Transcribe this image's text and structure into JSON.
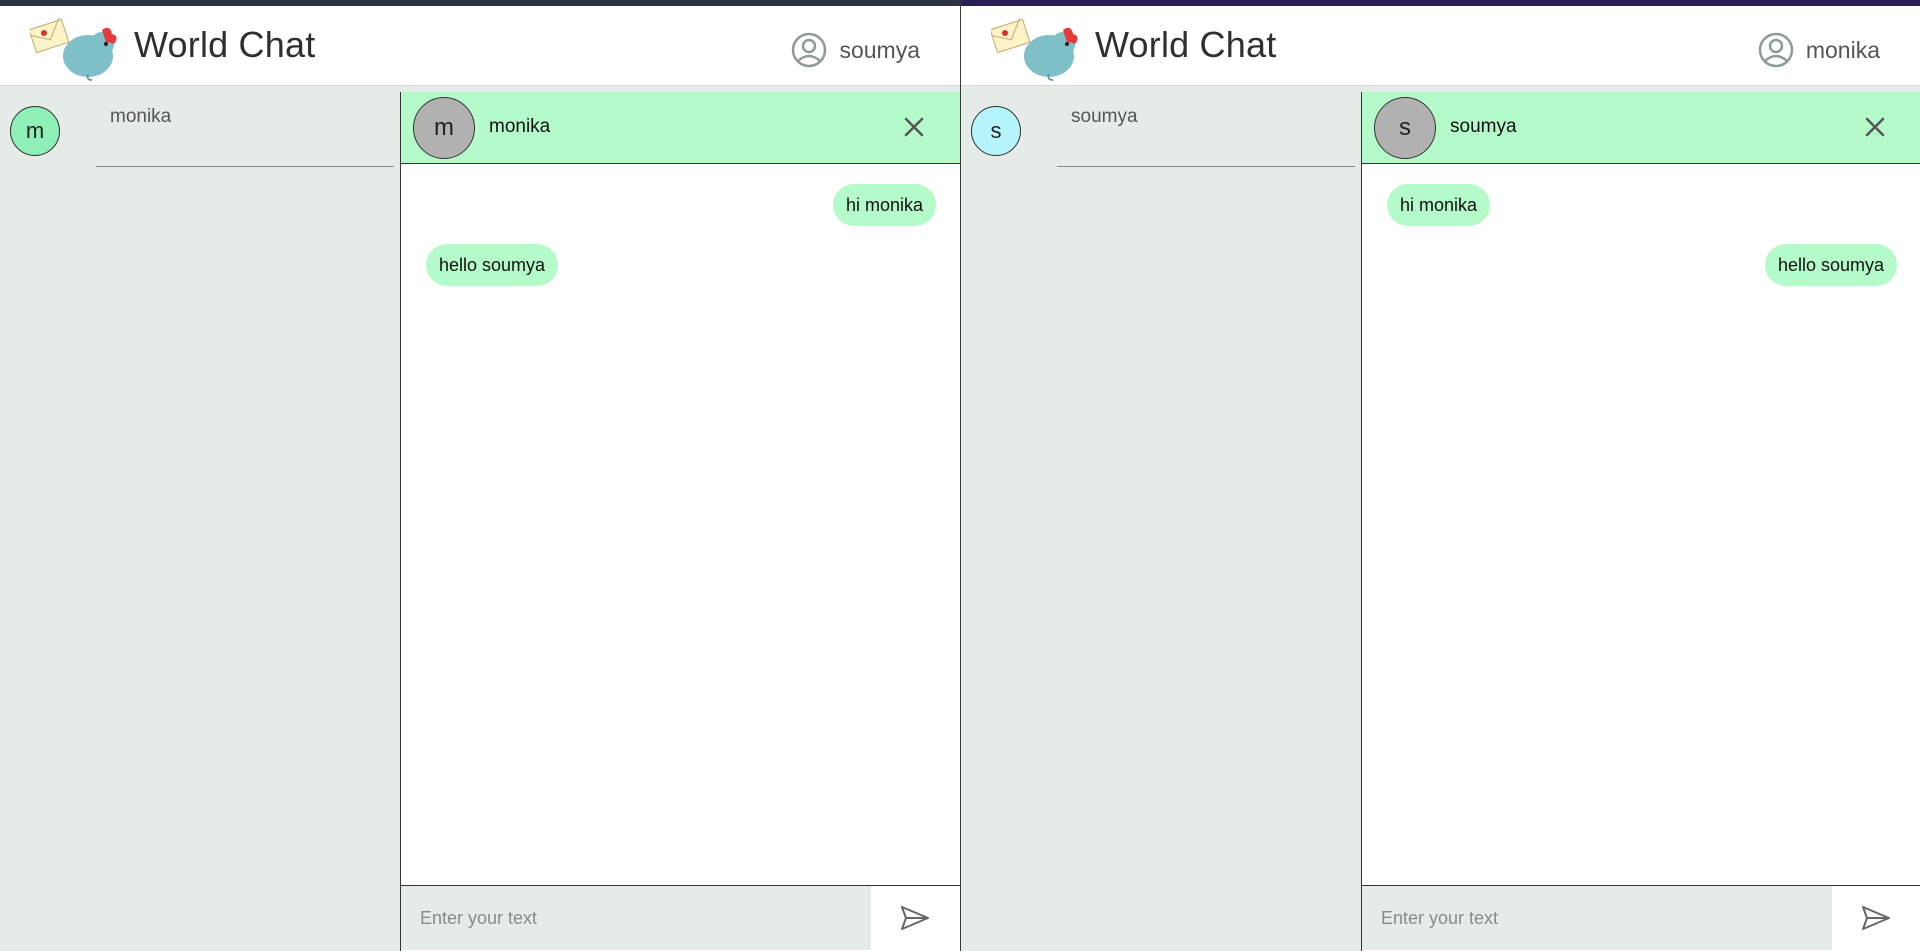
{
  "colors": {
    "sidebar_bg": "#e5ece8",
    "bubble": "#b4fbc9",
    "chat_header": "#b4fbc9",
    "avatar_monika": "#8ef0b6",
    "avatar_soumya": "#b6f4fb",
    "chat_avatar": "#b1b1b1"
  },
  "left": {
    "header": {
      "title": "World Chat",
      "user_name": "soumya",
      "user_icon": "account-circle-icon"
    },
    "contacts": [
      {
        "initial": "m",
        "name": "monika"
      }
    ],
    "chat": {
      "avatar_initial": "m",
      "name": "monika",
      "messages": [
        {
          "text": "hi monika",
          "side": "right"
        },
        {
          "text": "hello soumya",
          "side": "left"
        }
      ],
      "input_placeholder": "Enter your text"
    }
  },
  "right": {
    "header": {
      "title": "World Chat",
      "user_name": "monika",
      "user_icon": "account-circle-icon"
    },
    "contacts": [
      {
        "initial": "s",
        "name": "soumya"
      }
    ],
    "chat": {
      "avatar_initial": "s",
      "name": "soumya",
      "messages": [
        {
          "text": "hi monika",
          "side": "left"
        },
        {
          "text": "hello soumya",
          "side": "right"
        }
      ],
      "input_placeholder": "Enter your text"
    }
  }
}
